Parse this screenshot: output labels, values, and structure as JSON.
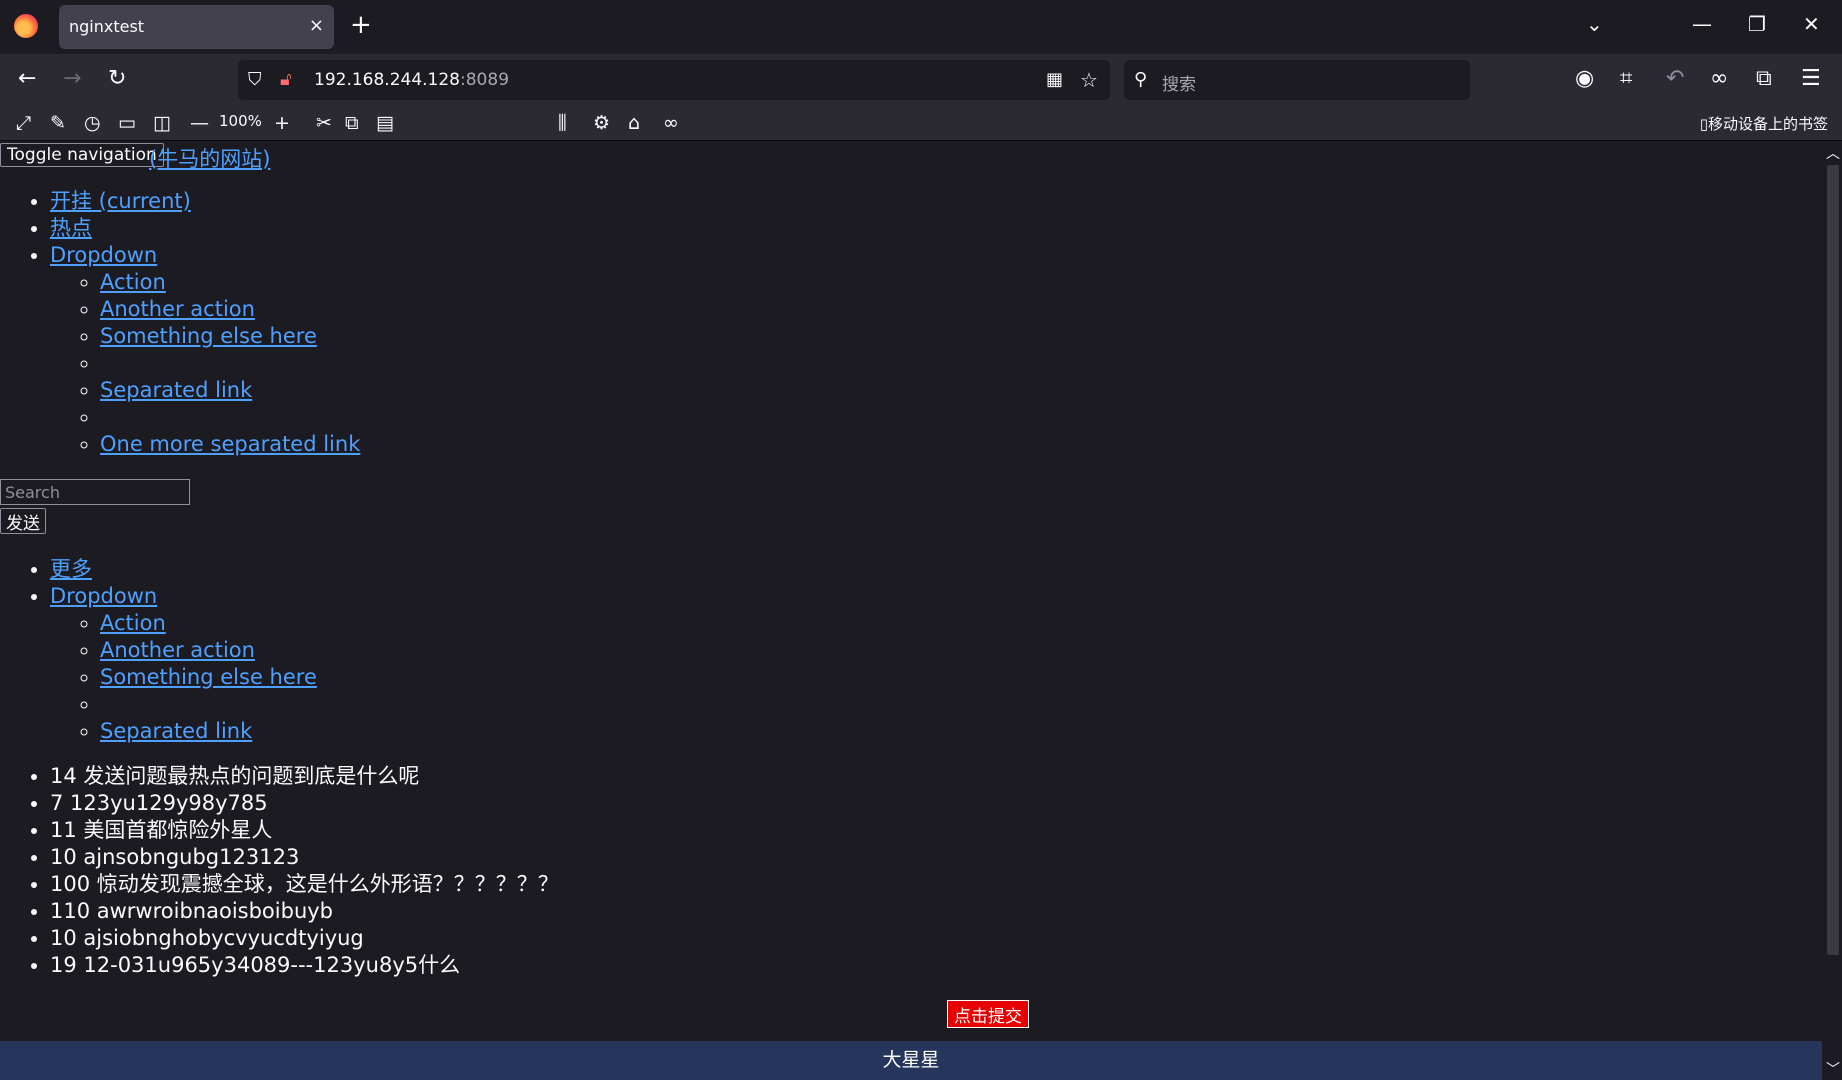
{
  "browser": {
    "tab_title": "nginxtest",
    "tab_close": "×",
    "new_tab": "+",
    "url_host": "192.168.244.128",
    "url_port": ":8089",
    "search_placeholder": "搜索",
    "zoom_level": "100%",
    "mobile_bookmarks": "移动设备上的书签"
  },
  "page": {
    "toggle_label": "Toggle navigation",
    "brand": "(牛马的网站)",
    "nav": [
      {
        "label": "开挂 (current)"
      },
      {
        "label": "热点"
      },
      {
        "label": "Dropdown"
      }
    ],
    "dropdown1": [
      "Action",
      "Another action",
      "Something else here",
      "",
      "Separated link",
      "",
      "One more separated link"
    ],
    "search_placeholder": "Search",
    "send_label": "发送",
    "nav2": [
      {
        "label": "更多"
      },
      {
        "label": "Dropdown"
      }
    ],
    "dropdown2": [
      "Action",
      "Another action",
      "Something else here",
      "",
      "Separated link"
    ],
    "hot_items": [
      "14 发送问题最热点的问题到底是什么呢",
      "7 123yu129y98y785",
      "11 美国首都惊险外星人",
      "10 ajnsobngubg123123",
      "100 惊动发现震撼全球，这是什么外形语？？？？？？",
      "110 awrwroibnaoisboibuyb",
      "10 ajsiobnghobycvyucdtyiyug",
      "19 12-031u965y34089---123yu8y5什么"
    ],
    "submit_label": "点击提交",
    "footer_text": "大星星"
  }
}
